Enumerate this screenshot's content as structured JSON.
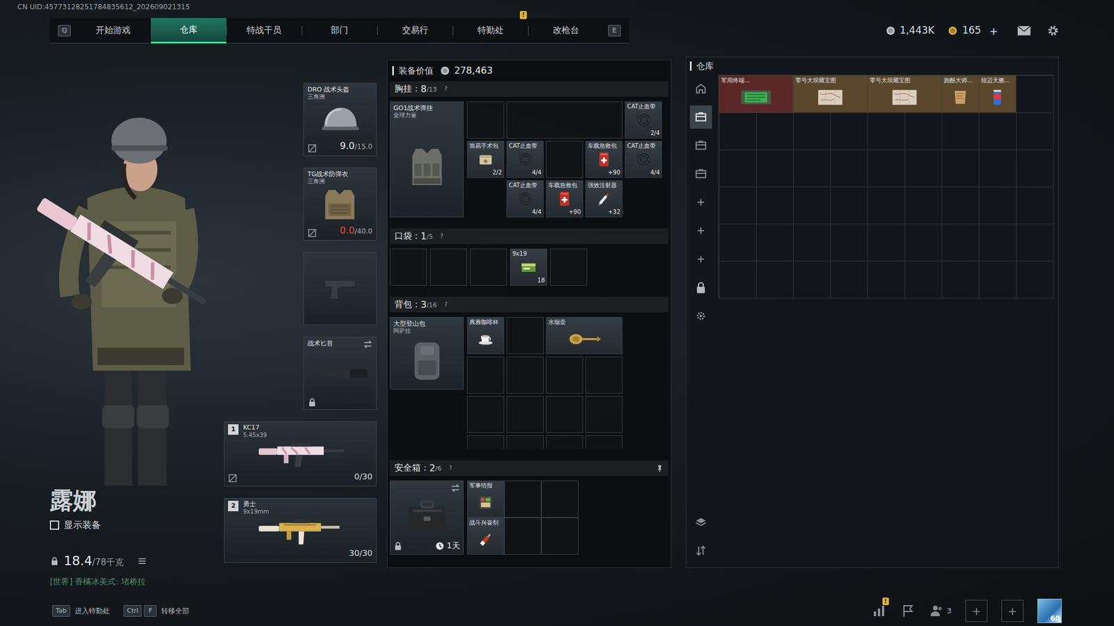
{
  "uid": "CN UID:45773128251784835612_202609021315",
  "nav": {
    "prev_key": "Q",
    "next_key": "E",
    "tabs": [
      {
        "label": "开始游戏",
        "selected": false
      },
      {
        "label": "仓库",
        "selected": true
      },
      {
        "label": "特战干员",
        "selected": false
      },
      {
        "label": "部门",
        "selected": false
      },
      {
        "label": "交易行",
        "selected": false
      },
      {
        "label": "特勤处",
        "selected": false,
        "alert": "!"
      },
      {
        "label": "改枪台",
        "selected": false
      }
    ]
  },
  "currency": [
    {
      "kind": "silver",
      "amount": "1,443K"
    },
    {
      "kind": "gold",
      "amount": "165",
      "action": "+"
    }
  ],
  "operator": {
    "name": "露娜",
    "show_gear": {
      "label": "显示装备",
      "checked": false
    },
    "weight": {
      "current": "18.4",
      "max": "/78千克"
    },
    "chat": "[世界] 香橘冰美式: 堵桥拉"
  },
  "gear": {
    "helmet": {
      "name": "DRO 战术头盔",
      "brand": "三角洲",
      "durability": "9.0",
      "max": "/15.0",
      "broken": false,
      "repairable": false
    },
    "armor": {
      "name": "TG战术防弹衣",
      "brand": "三角洲",
      "durability": "0.0",
      "max": "/40.0",
      "broken": true,
      "repairable": false
    },
    "pistol": {
      "empty": true
    },
    "melee": {
      "name": "战术匕首",
      "locked": true
    },
    "weapons": [
      {
        "slot": "1",
        "name": "KC17",
        "caliber": "5.45x39",
        "ammo": "0/30",
        "kind": "rifle",
        "repairable": false
      },
      {
        "slot": "2",
        "name": "勇士",
        "caliber": "9x19mm",
        "ammo": "30/30",
        "kind": "smg",
        "repairable": true
      }
    ]
  },
  "loadout": {
    "label": "装备价值",
    "value": "278,463"
  },
  "chest": {
    "label": "胸挂：",
    "used": "8",
    "capacity": "/13",
    "help": "?",
    "container": {
      "name": "GO1战术弹挂",
      "brand": "全球力量"
    },
    "items": [
      {
        "name": "CAT止血带",
        "count": "2/4",
        "kind": "tourniquet"
      },
      {
        "name": "简易手术包",
        "count": "2/2",
        "kind": "surgery"
      },
      {
        "name": "CAT止血带",
        "count": "4/4",
        "kind": "tourniquet"
      },
      {
        "name": "车载急救包",
        "count": "+90",
        "kind": "medkit"
      },
      {
        "name": "CAT止血带",
        "count": "4/4",
        "kind": "tourniquet"
      },
      {
        "name": "CAT止血带",
        "count": "4/4",
        "kind": "tourniquet"
      },
      {
        "name": "车载急救包",
        "count": "+90",
        "kind": "medkit"
      },
      {
        "name": "强效注射器",
        "count": "+32",
        "kind": "injector"
      }
    ]
  },
  "pocket": {
    "label": "口袋：",
    "used": "1",
    "capacity": "/5",
    "help": "?",
    "items": [
      {
        "name": "9x19",
        "count": "18",
        "kind": "ammo"
      }
    ]
  },
  "backpack": {
    "label": "背包：",
    "used": "3",
    "capacity": "/16",
    "help": "?",
    "container": {
      "name": "大型登山包",
      "brand": "阿萨拉"
    },
    "items": [
      {
        "name": "典雅咖啡杯",
        "kind": "cup"
      },
      {
        "name": "水烟壶",
        "kind": "hookah"
      }
    ]
  },
  "safe": {
    "label": "安全箱：",
    "used": "2",
    "capacity": "/6",
    "help": "?",
    "timer": "1天",
    "items": [
      {
        "name": "军事情报",
        "kind": "intel"
      },
      {
        "name": "战斗兴奋剂",
        "kind": "stimulant"
      }
    ]
  },
  "warehouse": {
    "title": "仓库",
    "tabs": [
      {
        "kind": "home",
        "selected": false
      },
      {
        "kind": "stash",
        "selected": true
      },
      {
        "kind": "stash",
        "selected": false
      },
      {
        "kind": "stash",
        "selected": false
      },
      {
        "kind": "add",
        "selected": false
      },
      {
        "kind": "add",
        "selected": false
      },
      {
        "kind": "add",
        "selected": false
      },
      {
        "kind": "lock",
        "selected": false
      },
      {
        "kind": "settings",
        "selected": false
      }
    ],
    "tools": [
      {
        "kind": "layers"
      },
      {
        "kind": "sort"
      }
    ],
    "items": [
      {
        "name": "军用终端...",
        "kind": "terminal",
        "color": "#5a2626"
      },
      {
        "name": "零号大坝藏宝图",
        "kind": "map",
        "color": "#5a472c"
      },
      {
        "name": "零号大坝藏宝图",
        "kind": "map",
        "color": "#5a472c"
      },
      {
        "name": "跑酷大师...",
        "kind": "doc",
        "color": "#5a472c"
      },
      {
        "name": "炫迈天籁...",
        "kind": "snack",
        "color": "#5a472c"
      }
    ]
  },
  "bottom": {
    "hints": [
      {
        "keys": [
          "Tab"
        ],
        "label": "进入特勤处"
      },
      {
        "keys": [
          "Ctrl",
          "F"
        ],
        "label": "转移全部"
      }
    ],
    "alert": "!",
    "team_count": "3",
    "level": "60"
  }
}
